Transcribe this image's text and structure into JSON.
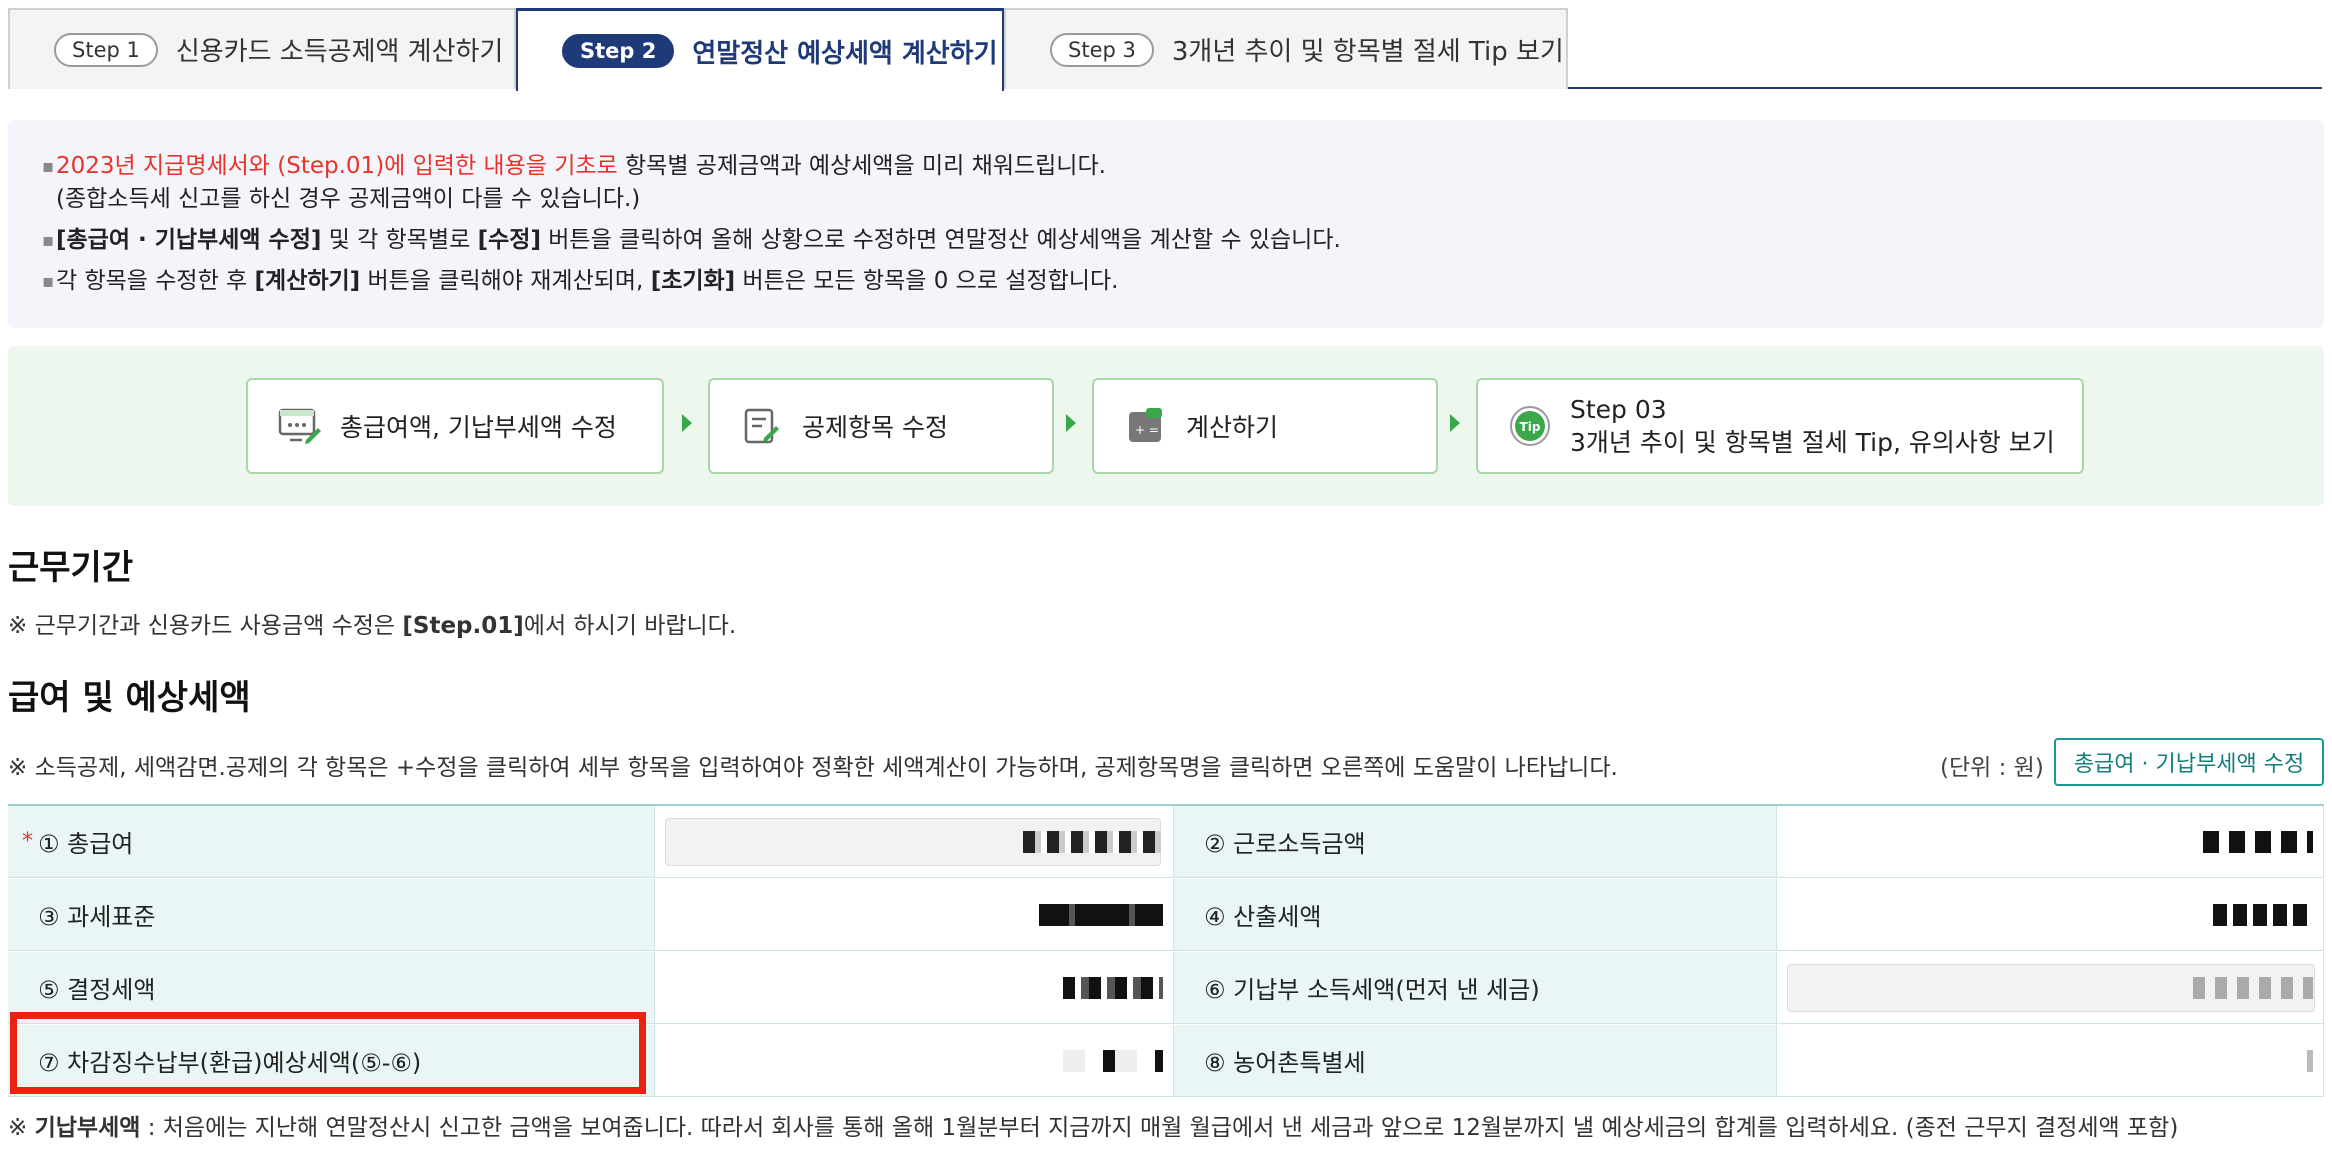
{
  "tabs": [
    {
      "step": "Step 1",
      "label": "신용카드 소득공제액 계산하기"
    },
    {
      "step": "Step 2",
      "label": "연말정산 예상세액 계산하기"
    },
    {
      "step": "Step 3",
      "label": "3개년 추이 및 항목별 절세 Tip 보기"
    }
  ],
  "info": {
    "line1_red": "2023년 지급명세서와 (Step.01)에 입력한 내용을 기초로",
    "line1_rest": " 항목별 공제금액과 예상세액을 미리 채워드립니다.",
    "line1b": "(종합소득세 신고를 하신 경우 공제금액이 다를 수 있습니다.)",
    "line2_b1": "[총급여 · 기납부세액 수정]",
    "line2_m1": " 및 각 항목별로 ",
    "line2_b2": "[수정]",
    "line2_m2": " 버튼을 클릭하여 올해 상황으로 수정하면 연말정산 예상세액을 계산할 수 있습니다.",
    "line3_m1": "각 항목을 수정한 후 ",
    "line3_b1": "[계산하기]",
    "line3_m2": " 버튼을 클릭해야 재계산되며, ",
    "line3_b2": "[초기화]",
    "line3_m3": " 버튼은 모든 항목을 0 으로 설정합니다."
  },
  "process": [
    {
      "label": "총급여액, 기납부세액 수정",
      "icon": "monitor-edit-icon"
    },
    {
      "label": "공제항목 수정",
      "icon": "document-edit-icon"
    },
    {
      "label": "계산하기",
      "icon": "calculator-icon"
    },
    {
      "label_top": "Step 03",
      "label": "3개년 추이 및 항목별 절세 Tip, 유의사항 보기",
      "icon": "tip-icon",
      "icon_text": "Tip"
    }
  ],
  "section1": {
    "title": "근무기간",
    "note_pre": "※ 근무기간과 신용카드 사용금액 수정은 ",
    "note_b": "[Step.01]",
    "note_post": "에서 하시기 바랍니다."
  },
  "section2": {
    "title": "급여 및 예상세액",
    "note": "※ 소득공제, 세액감면.공제의 각 항목은 +수정을 클릭하여 세부 항목을 입력하여야 정확한 세액계산이 가능하며, 공제항목명을 클릭하면 오른쪽에 도움말이 나타납니다.",
    "unit": "(단위 : 원)",
    "edit_button": "총급여 · 기납부세액 수정"
  },
  "table": {
    "rows": [
      {
        "l1": "① 총급여",
        "l2": "② 근로소득금액",
        "required": "*"
      },
      {
        "l1": "③ 과세표준",
        "l2": "④ 산출세액"
      },
      {
        "l1": "⑤ 결정세액",
        "l2": "⑥ 기납부 소득세액(먼저 낸 세금)"
      },
      {
        "l1": "⑦ 차감징수납부(환급)예상세액(⑤-⑥)",
        "l2": "⑧ 농어촌특별세"
      }
    ]
  },
  "footnote": {
    "pre": "※ ",
    "b": "기납부세액",
    "post": " : 처음에는 지난해 연말정산시 신고한 금액을 보여줍니다. 따라서 회사를 통해 올해 1월분부터 지금까지 매월 월급에서 낸 세금과 앞으로 12월분까지 낼 예상세금의 합계를 입력하세요. (종전 근무지 결정세액 포함)"
  },
  "colors": {
    "accent": "#1f3a78",
    "red": "#e8332a",
    "green": "#3aa84a",
    "teal": "#1a9a96"
  }
}
